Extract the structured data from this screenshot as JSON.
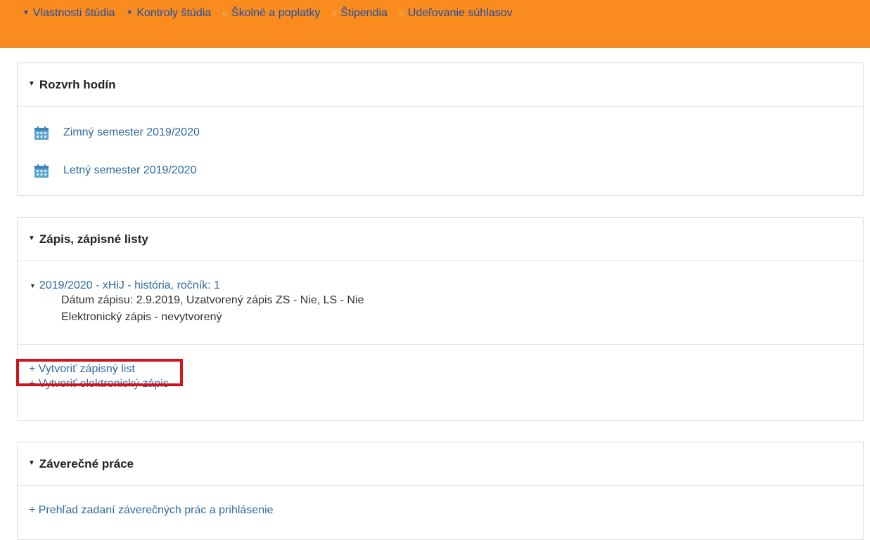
{
  "nav": {
    "items": [
      {
        "marker": "▼",
        "label": "Vlastnosti štúdia"
      },
      {
        "marker": "▼",
        "label": "Kontroly štúdia"
      },
      {
        "marker": "○",
        "label": "Školné a poplatky"
      },
      {
        "marker": "○",
        "label": "Štipendia"
      },
      {
        "marker": "○",
        "label": "Udeľovanie súhlasov"
      }
    ]
  },
  "schedule": {
    "title": "Rozvrh hodín",
    "semesters": [
      "Zimný semester 2019/2020",
      "Letný semester 2019/2020"
    ]
  },
  "enrollment": {
    "title": "Zápis, zápisné listy",
    "item_title": "2019/2020 - xHiJ - história, ročník: 1",
    "detail_1": "Dátum zápisu: 2.9.2019, Uzatvorený zápis ZS - Nie, LS - Nie",
    "detail_2": "Elektronický zápis - nevytvorený",
    "create_sheet": "+ Vytvoriť zápisný list",
    "create_electronic": "+ Vytvoriť elektronický zápis"
  },
  "thesis": {
    "title": "Záverečné práce",
    "link": "+ Prehľad zadaní záverečných prác a prihlásenie"
  },
  "colors": {
    "nav_bg": "#f98b1f",
    "link": "#2e6aa3",
    "highlight": "#d3131b"
  }
}
